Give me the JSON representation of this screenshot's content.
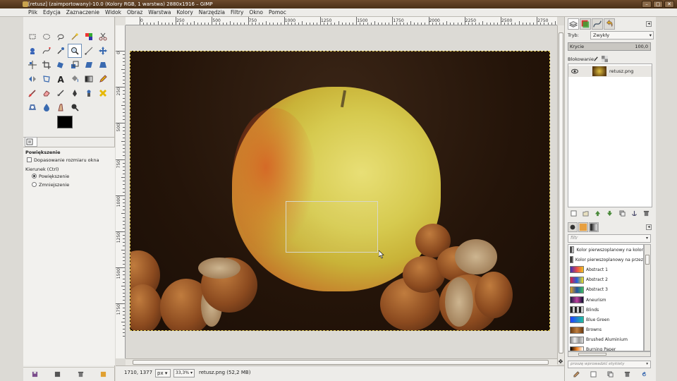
{
  "window": {
    "title": "[retusz] (zaimportowany)-10.0 (Kolory RGB, 1 warstwa) 2880x1916 – GIMP",
    "controls": [
      "–",
      "▢",
      "✕"
    ]
  },
  "menubar": [
    "Plik",
    "Edycja",
    "Zaznaczenie",
    "Widok",
    "Obraz",
    "Warstwa",
    "Kolory",
    "Narzędzia",
    "Filtry",
    "Okno",
    "Pomoc"
  ],
  "toolbox": {
    "tools": [
      "rect-select-icon",
      "ellipse-select-icon",
      "lasso-icon",
      "fuzzy-select-icon",
      "color-select-icon",
      "scissors-icon",
      "foreground-select-icon",
      "paths-icon",
      "color-picker-icon",
      "zoom-icon",
      "measure-icon",
      "move-icon",
      "align-icon",
      "crop-icon",
      "rotate-icon",
      "scale-icon",
      "shear-icon",
      "perspective-icon",
      "flip-icon",
      "cage-icon",
      "text-icon",
      "bucket-fill-icon",
      "blend-icon",
      "pencil-icon",
      "paintbrush-icon",
      "eraser-icon",
      "airbrush-icon",
      "ink-icon",
      "clone-icon",
      "heal-icon",
      "perspective-clone-icon",
      "blur-icon",
      "smudge-icon",
      "dodge-icon"
    ],
    "active_tool_index": 9,
    "fg_color": "#000000",
    "bg_color": "#ffffff"
  },
  "tool_options": {
    "title": "Powiększenie",
    "resize_window_label": "Dopasowanie rozmiaru okna",
    "direction_label": "Kierunek  (Ctrl)",
    "zoom_in_label": "Powiększenie",
    "zoom_out_label": "Zmniejszenie"
  },
  "rulers": {
    "h_labels": [
      "0",
      "250",
      "500",
      "750",
      "1000",
      "1250",
      "1500",
      "1750",
      "2000",
      "2250",
      "2500",
      "2750"
    ],
    "v_labels": [
      "0",
      "250",
      "500",
      "750",
      "1000",
      "1250",
      "1500",
      "1750"
    ]
  },
  "statusbar": {
    "coords": "1710, 1377",
    "unit": "px",
    "zoom": "33,3%",
    "file": "retusz.png (52,2 MB)"
  },
  "layers": {
    "mode_label": "Tryb:",
    "mode_value": "Zwykły",
    "opacity_label": "Krycie",
    "opacity_value": "100,0",
    "lock_label": "Blokowanie:",
    "layer_name": "retusz.png"
  },
  "gradients": {
    "filter_placeholder": "filtr",
    "tag_placeholder": "proszę wprowadzić etykiety",
    "items": [
      {
        "name": "Kolor pierwszoplanowy na kolor",
        "swatch": "linear-gradient(90deg,#000,#fff)"
      },
      {
        "name": "Kolor pierwszoplanowy na przez",
        "swatch": "linear-gradient(90deg,#000,#888)"
      },
      {
        "name": "Abstract 1",
        "swatch": "linear-gradient(90deg,#3b2fb5,#e84a4a,#f0c020)"
      },
      {
        "name": "Abstract 2",
        "swatch": "linear-gradient(90deg,#e02040,#2060e0,#f0e020)"
      },
      {
        "name": "Abstract 3",
        "swatch": "linear-gradient(90deg,#e0a020,#2050a0,#40c060)"
      },
      {
        "name": "Aneurism",
        "swatch": "linear-gradient(90deg,#1a1a40,#c040a0,#101030)"
      },
      {
        "name": "Blinds",
        "swatch": "repeating-linear-gradient(90deg,#222 0 3px,#ccc 3px 6px)"
      },
      {
        "name": "Blue Green",
        "swatch": "linear-gradient(90deg,#2040ff,#20c0a0)"
      },
      {
        "name": "Browns",
        "swatch": "linear-gradient(90deg,#6a3a10,#c08040,#6a3a10)"
      },
      {
        "name": "Brushed Aluminium",
        "swatch": "linear-gradient(90deg,#888,#eee,#999,#ddd)"
      },
      {
        "name": "Burning Paper",
        "swatch": "linear-gradient(90deg,#000,#f08020,#fff)"
      }
    ]
  }
}
